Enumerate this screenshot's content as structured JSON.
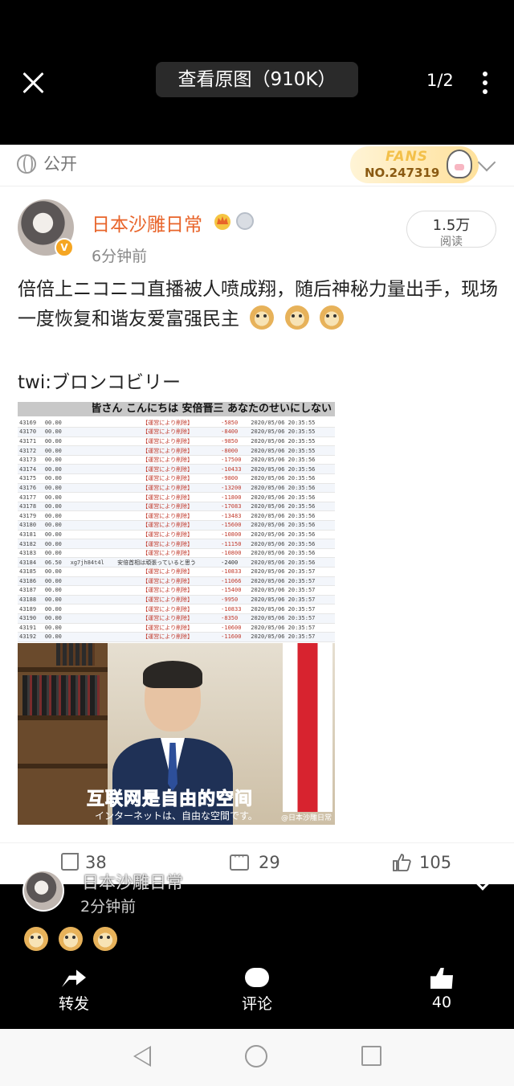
{
  "viewer": {
    "view_original_label": "查看原图（910K）",
    "page_counter": "1/2"
  },
  "card": {
    "visibility": "公开",
    "fans_badge": {
      "title": "FANS",
      "number": "NO.247319"
    },
    "author": {
      "name": "日本沙雕日常",
      "verified_mark": "V",
      "time": "6分钟前"
    },
    "reads": {
      "count": "1.5万",
      "label": "阅读"
    },
    "post_text": "倍倍上ニコニコ直播被人喷成翔，随后神秘力量出手，现场一度恢复和谐友爱富强民主",
    "twi_line": "twi:ブロンコビリー",
    "image": {
      "banner": "皆さん こんにちは 安倍晋三 あなたのせいにしない",
      "rows": [
        {
          "id": "43169",
          "col2": "00.00",
          "user": "",
          "msg": "【運営により削除】",
          "amt": "-5850",
          "ts": "2020/05/06 20:35:55"
        },
        {
          "id": "43170",
          "col2": "00.00",
          "user": "",
          "msg": "【運営により削除】",
          "amt": "-8400",
          "ts": "2020/05/06 20:35:55"
        },
        {
          "id": "43171",
          "col2": "00.00",
          "user": "",
          "msg": "【運営により削除】",
          "amt": "-9850",
          "ts": "2020/05/06 20:35:55"
        },
        {
          "id": "43172",
          "col2": "00.00",
          "user": "",
          "msg": "【運営により削除】",
          "amt": "-8000",
          "ts": "2020/05/06 20:35:55"
        },
        {
          "id": "43173",
          "col2": "00.00",
          "user": "",
          "msg": "【運営により削除】",
          "amt": "-17500",
          "ts": "2020/05/06 20:35:56"
        },
        {
          "id": "43174",
          "col2": "00.00",
          "user": "",
          "msg": "【運営により削除】",
          "amt": "-10433",
          "ts": "2020/05/06 20:35:56"
        },
        {
          "id": "43175",
          "col2": "00.00",
          "user": "",
          "msg": "【運営により削除】",
          "amt": "-9800",
          "ts": "2020/05/06 20:35:56"
        },
        {
          "id": "43176",
          "col2": "00.00",
          "user": "",
          "msg": "【運営により削除】",
          "amt": "-13200",
          "ts": "2020/05/06 20:35:56"
        },
        {
          "id": "43177",
          "col2": "00.00",
          "user": "",
          "msg": "【運営により削除】",
          "amt": "-11800",
          "ts": "2020/05/06 20:35:56"
        },
        {
          "id": "43178",
          "col2": "00.00",
          "user": "",
          "msg": "【運営により削除】",
          "amt": "-17083",
          "ts": "2020/05/06 20:35:56"
        },
        {
          "id": "43179",
          "col2": "00.00",
          "user": "",
          "msg": "【運営により削除】",
          "amt": "-13483",
          "ts": "2020/05/06 20:35:56"
        },
        {
          "id": "43180",
          "col2": "00.00",
          "user": "",
          "msg": "【運営により削除】",
          "amt": "-15600",
          "ts": "2020/05/06 20:35:56"
        },
        {
          "id": "43181",
          "col2": "00.00",
          "user": "",
          "msg": "【運営により削除】",
          "amt": "-10800",
          "ts": "2020/05/06 20:35:56"
        },
        {
          "id": "43182",
          "col2": "00.00",
          "user": "",
          "msg": "【運営により削除】",
          "amt": "-11150",
          "ts": "2020/05/06 20:35:56"
        },
        {
          "id": "43183",
          "col2": "00.00",
          "user": "",
          "msg": "【運営により削除】",
          "amt": "-10800",
          "ts": "2020/05/06 20:35:56"
        },
        {
          "id": "43184",
          "col2": "06.50",
          "user": "xg7jh84t4l",
          "msg": "安倍首相は頑張っていると思う",
          "amt": "-2400",
          "ts": "2020/05/06 20:35:56",
          "special": true
        },
        {
          "id": "43185",
          "col2": "00.00",
          "user": "",
          "msg": "【運営により削除】",
          "amt": "-10833",
          "ts": "2020/05/06 20:35:57"
        },
        {
          "id": "43186",
          "col2": "00.00",
          "user": "",
          "msg": "【運営により削除】",
          "amt": "-11066",
          "ts": "2020/05/06 20:35:57"
        },
        {
          "id": "43187",
          "col2": "00.00",
          "user": "",
          "msg": "【運営により削除】",
          "amt": "-15400",
          "ts": "2020/05/06 20:35:57"
        },
        {
          "id": "43188",
          "col2": "00.00",
          "user": "",
          "msg": "【運営により削除】",
          "amt": "-9950",
          "ts": "2020/05/06 20:35:57"
        },
        {
          "id": "43189",
          "col2": "00.00",
          "user": "",
          "msg": "【運営により削除】",
          "amt": "-10833",
          "ts": "2020/05/06 20:35:57"
        },
        {
          "id": "43190",
          "col2": "00.00",
          "user": "",
          "msg": "【運営により削除】",
          "amt": "-8350",
          "ts": "2020/05/06 20:35:57"
        },
        {
          "id": "43191",
          "col2": "00.00",
          "user": "",
          "msg": "【運営により削除】",
          "amt": "-10600",
          "ts": "2020/05/06 20:35:57"
        },
        {
          "id": "43192",
          "col2": "00.00",
          "user": "",
          "msg": "【運営により削除】",
          "amt": "-11600",
          "ts": "2020/05/06 20:35:57"
        }
      ],
      "caption_cn": "互联网是自由的空间",
      "caption_jp": "インターネットは、自由な空間です。",
      "watermark": "@日本沙雕日常"
    },
    "actions": {
      "share_count": "38",
      "comment_count": "29",
      "like_count": "105"
    }
  },
  "bottom": {
    "author_name": "日本沙雕日常",
    "time": "2分钟前",
    "repost_label": "转发",
    "comment_label": "评论",
    "like_count": "40"
  },
  "colors": {
    "accent_orange": "#e8642a",
    "deleted_red": "#c0392b"
  }
}
